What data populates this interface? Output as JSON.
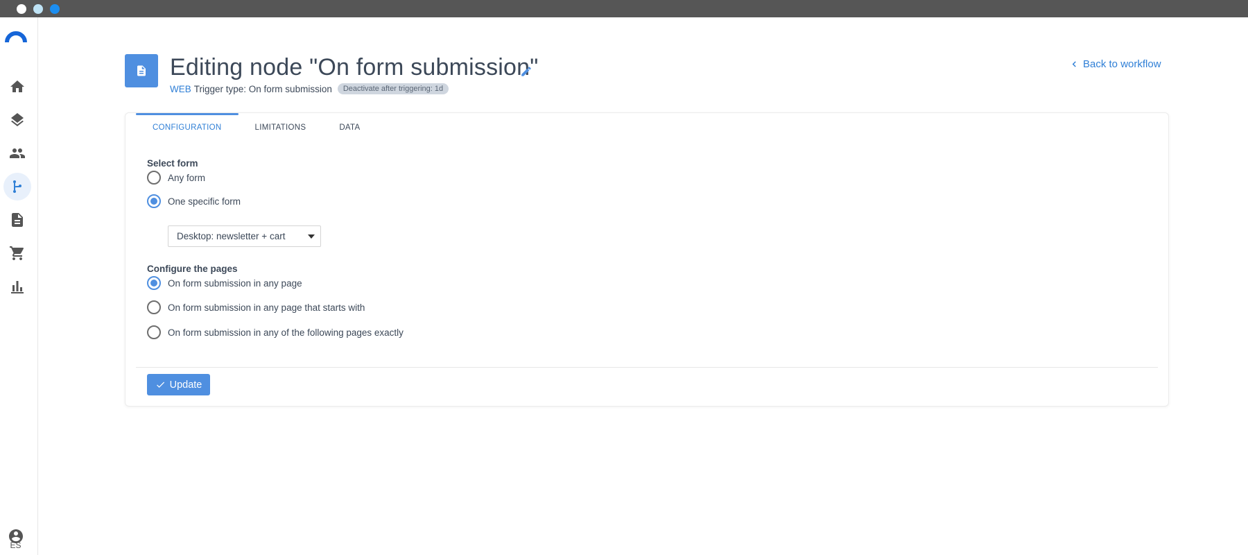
{
  "header": {
    "title": "Editing node \"On form submission\"",
    "web_tag": "WEB",
    "trigger_text": "Trigger type: On form submission",
    "deactivate_badge": "Deactivate after triggering: 1d",
    "back_link": "Back to workflow"
  },
  "sidebar": {
    "items": [
      {
        "icon": "home-icon"
      },
      {
        "icon": "layers-icon"
      },
      {
        "icon": "people-icon"
      },
      {
        "icon": "workflow-icon",
        "active": true
      },
      {
        "icon": "document-icon"
      },
      {
        "icon": "cart-icon"
      },
      {
        "icon": "bar-chart-icon"
      }
    ],
    "language": "ES"
  },
  "tabs": [
    {
      "label": "CONFIGURATION",
      "active": true
    },
    {
      "label": "LIMITATIONS",
      "active": false
    },
    {
      "label": "DATA",
      "active": false
    }
  ],
  "form": {
    "select_form_label": "Select form",
    "select_form_options": [
      {
        "label": "Any form",
        "checked": false
      },
      {
        "label": "One specific form",
        "checked": true
      }
    ],
    "form_dropdown_value": "Desktop: newsletter + cart",
    "pages_label": "Configure the pages",
    "pages_options": [
      {
        "label": "On form submission in any page",
        "checked": true
      },
      {
        "label": "On form submission in any page that starts with",
        "checked": false
      },
      {
        "label": "On form submission in any of the following pages exactly",
        "checked": false
      }
    ]
  },
  "actions": {
    "update_label": "Update"
  },
  "colors": {
    "accent": "#4f8fe0",
    "link": "#2f7fd6",
    "titlebar": "#565656"
  }
}
